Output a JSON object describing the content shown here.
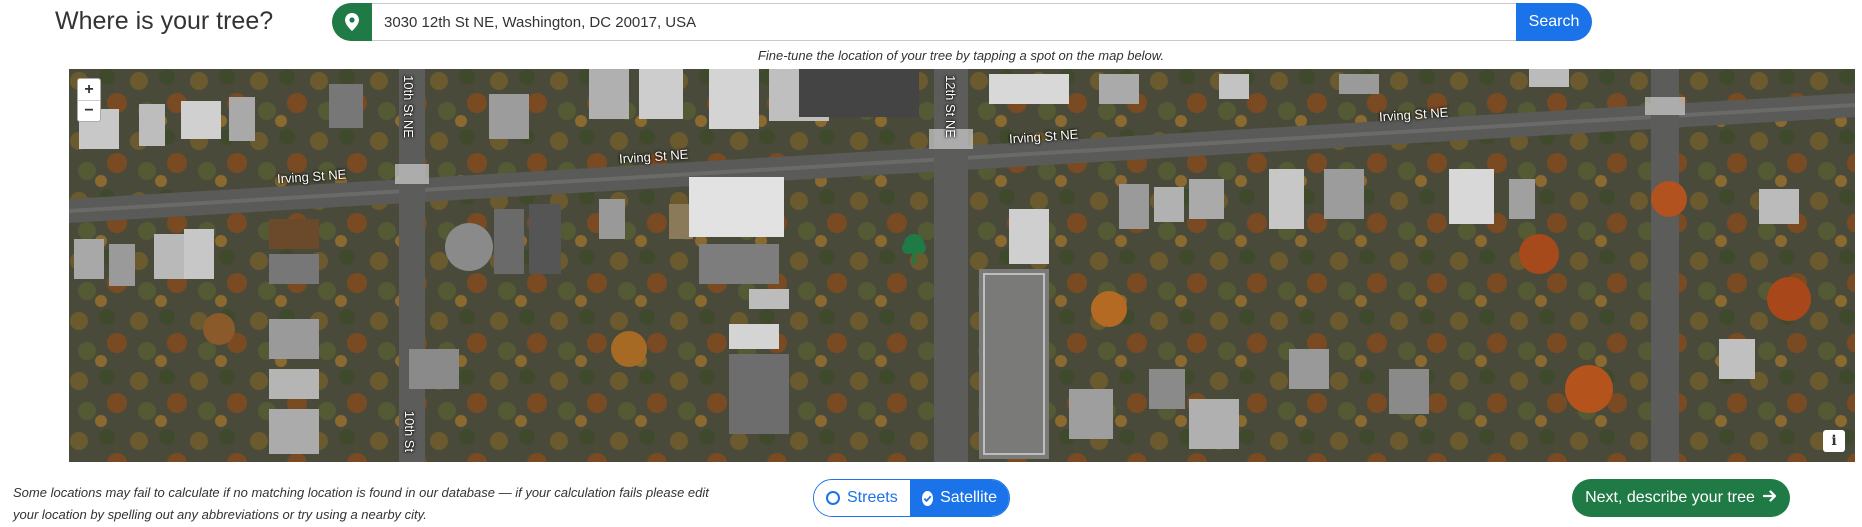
{
  "header": {
    "title": "Where is your tree?"
  },
  "search": {
    "value": "3030 12th St NE, Washington, DC 20017, USA",
    "button_label": "Search",
    "location_icon": "map-pin-icon"
  },
  "map": {
    "hint": "Fine-tune the location of your tree by tapping a spot on the map below.",
    "zoom_in_label": "+",
    "zoom_out_label": "−",
    "info_label": "i",
    "streets": {
      "irving_west": "Irving St NE",
      "irving_mid": "Irving St NE",
      "irving_east": "Irving St NE",
      "irving_far_east": "Irving St NE",
      "tenth_north": "10th St NE",
      "tenth_south": "10th St",
      "twelfth": "12th St NE"
    },
    "marker_icon": "tree-icon",
    "colors": {
      "tree_marker": "#1f7a45"
    }
  },
  "footer": {
    "note_line1": "Some locations may fail to calculate if no matching location is found in our database — if your calculation fails please edit",
    "note_line2": "your location by spelling out any abbreviations or try using a nearby city.",
    "layer_toggle": {
      "streets_label": "Streets",
      "satellite_label": "Satellite",
      "selected": "Satellite"
    },
    "next_label": "Next, describe your tree"
  },
  "colors": {
    "accent_blue": "#1a73e8",
    "brand_green": "#1f7a45"
  }
}
